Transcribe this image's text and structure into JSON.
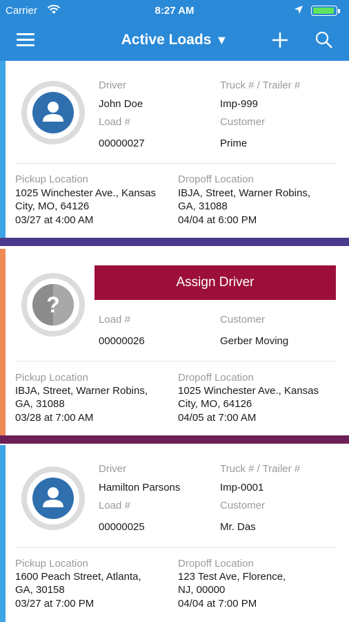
{
  "status_bar": {
    "carrier": "Carrier",
    "time": "8:27 AM",
    "battery_level": 1.0
  },
  "nav": {
    "title": "Active Loads",
    "title_caret": "▼",
    "menu_icon": "hamburger-menu-icon",
    "add_icon": "plus-icon",
    "search_icon": "search-icon"
  },
  "labels": {
    "driver": "Driver",
    "truck_trailer": "Truck # / Trailer #",
    "load": "Load #",
    "customer": "Customer",
    "pickup": "Pickup Location",
    "dropoff": "Dropoff Location"
  },
  "colors": {
    "header": "#2b8ad8",
    "accent_blue": "#3fa4e6",
    "accent_orange": "#ef8a55",
    "separator_purple": "#4b3a8c",
    "separator_plum": "#6e1f55",
    "assign_button": "#9c0f3a",
    "avatar_blue": "#2f6fae"
  },
  "loads": [
    {
      "driver": "John Doe",
      "truck": "Imp-999",
      "load_number": "00000027",
      "customer": "Prime",
      "pickup": {
        "line1": "1025 Winchester Ave., Kansas",
        "line2": "City, MO, 64126",
        "time": "03/27 at 4:00 AM"
      },
      "dropoff": {
        "line1": "IBJA, Street, Warner Robins,",
        "line2": "GA, 31088",
        "time": "04/04 at 6:00 PM"
      }
    },
    {
      "assign_label": "Assign Driver",
      "load_number": "00000026",
      "customer": "Gerber Moving",
      "pickup": {
        "line1": "IBJA, Street, Warner Robins,",
        "line2": "GA, 31088",
        "time": "03/28 at 7:00 AM"
      },
      "dropoff": {
        "line1": "1025 Winchester Ave., Kansas",
        "line2": "City, MO, 64126",
        "time": "04/05 at 7:00 AM"
      }
    },
    {
      "driver": "Hamilton Parsons",
      "truck": "Imp-0001",
      "load_number": "00000025",
      "customer": "Mr. Das",
      "pickup": {
        "line1": "1600 Peach Street, Atlanta,",
        "line2": "GA, 30158",
        "time": "03/27 at 7:00 PM"
      },
      "dropoff": {
        "line1": "123 Test Ave, Florence,",
        "line2": "NJ, 00000",
        "time": "04/04 at 7:00 PM"
      }
    }
  ]
}
